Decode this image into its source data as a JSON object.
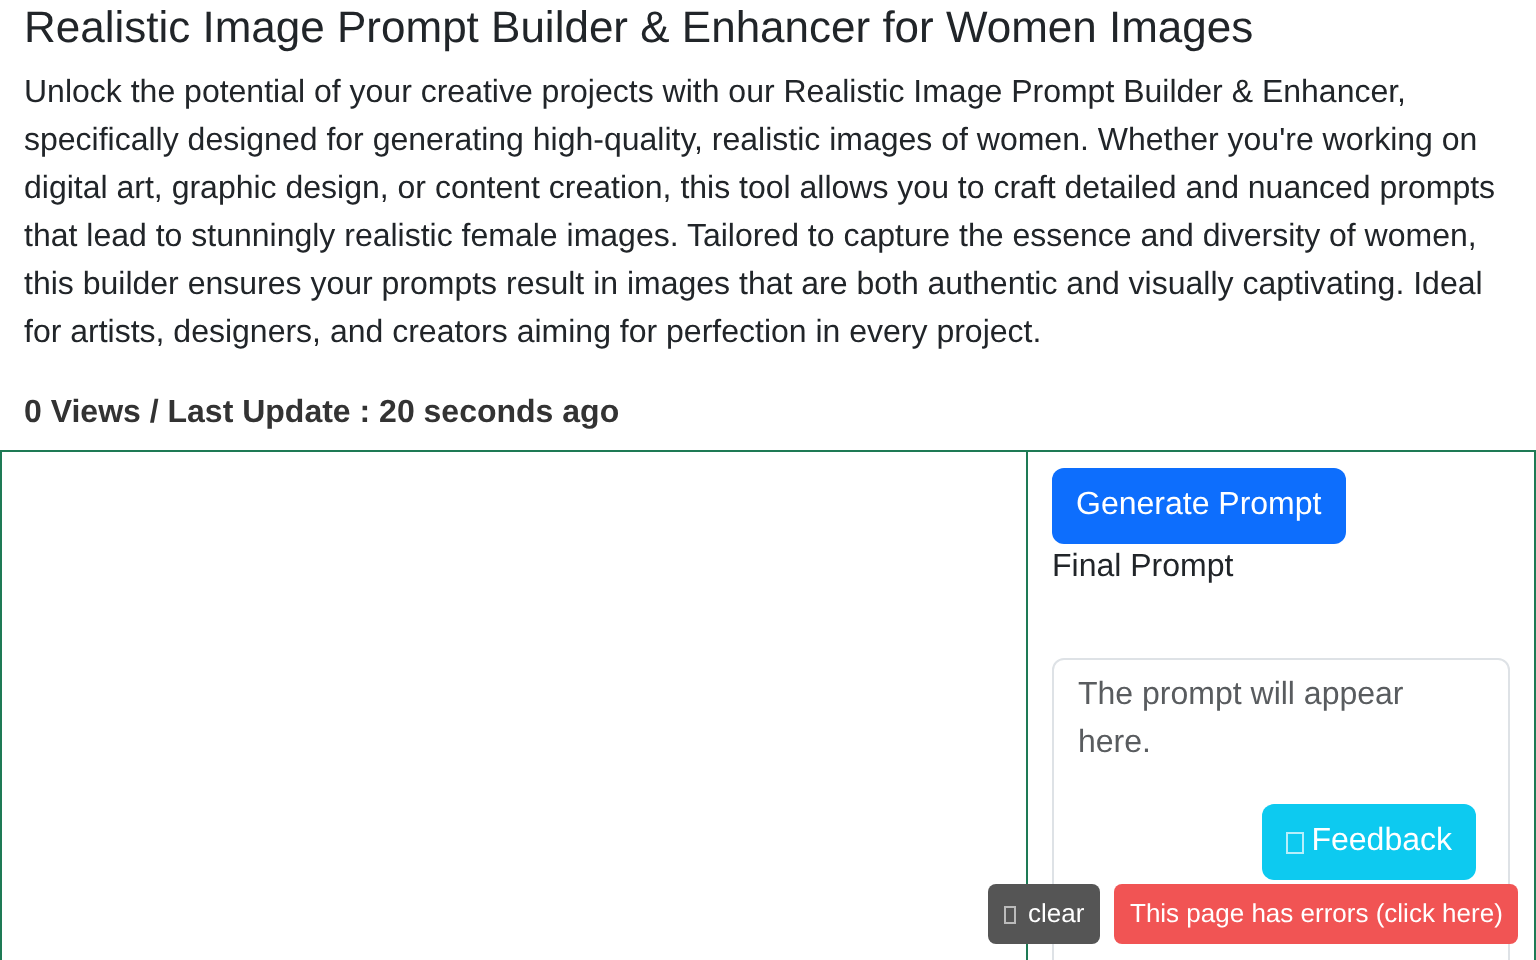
{
  "title": "Realistic Image Prompt Builder & Enhancer for Women Images",
  "description": "Unlock the potential of your creative projects with our Realistic Image Prompt Builder & Enhancer, specifically designed for generating high-quality, realistic images of women. Whether you're working on digital art, graphic design, or content creation, this tool allows you to craft detailed and nuanced prompts that lead to stunningly realistic female images. Tailored to capture the essence and diversity of women, this builder ensures your prompts result in images that are both authentic and visually captivating. Ideal for artists, designers, and creators aiming for perfection in every project.",
  "meta": "0 Views / Last Update : 20 seconds ago",
  "generate_button": "Generate Prompt",
  "final_prompt_label": "Final Prompt",
  "prompt_field": {
    "placeholder": "The prompt will appear here."
  },
  "feedback_button": "Feedback",
  "clear_button": "clear",
  "error_button": "This page has errors (click here)"
}
